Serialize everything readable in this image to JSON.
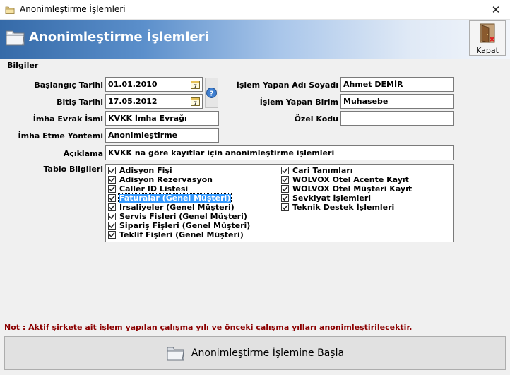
{
  "window": {
    "title": "Anonimleştirme İşlemleri",
    "close_glyph": "✕"
  },
  "header": {
    "title": "Anonimleştirme İşlemleri",
    "icon": "folder-icon"
  },
  "toolbar": {
    "close_label": "Kapat",
    "close_icon": "door-exit-icon"
  },
  "form": {
    "group_label": "Bilgiler",
    "start_date_label": "Başlangıç Tarihi",
    "start_date_value": "01.01.2010",
    "end_date_label": "Bitiş Tarihi",
    "end_date_value": "17.05.2012",
    "doc_name_label": "İmha Evrak İsmi",
    "doc_name_value": "KVKK İmha Evrağı",
    "method_label": "İmha Etme Yöntemi",
    "method_value": "Anonimleştirme",
    "user_label": "İşlem Yapan Adı Soyadı",
    "user_value": "Ahmet DEMİR",
    "unit_label": "İşlem Yapan Birim",
    "unit_value": "Muhasebe",
    "special_code_label": "Özel Kodu",
    "special_code_value": "",
    "description_label": "Açıklama",
    "description_value": "KVKK na göre kayıtlar için anonimleştirme işlemleri",
    "tables_label": "Tablo Bilgileri"
  },
  "tables": {
    "left": [
      {
        "label": "Adisyon Fişi",
        "checked": true,
        "selected": false
      },
      {
        "label": "Adisyon Rezervasyon",
        "checked": true,
        "selected": false
      },
      {
        "label": "Caller ID Listesi",
        "checked": true,
        "selected": false
      },
      {
        "label": "Faturalar (Genel Müşteri)",
        "checked": true,
        "selected": true
      },
      {
        "label": "İrsaliyeler (Genel Müşteri)",
        "checked": true,
        "selected": false
      },
      {
        "label": "Servis Fişleri (Genel Müşteri)",
        "checked": true,
        "selected": false
      },
      {
        "label": "Sipariş Fişleri (Genel Müşteri)",
        "checked": true,
        "selected": false
      },
      {
        "label": "Teklif Fişleri (Genel Müşteri)",
        "checked": true,
        "selected": false
      }
    ],
    "right": [
      {
        "label": "Cari Tanımları",
        "checked": true,
        "selected": false
      },
      {
        "label": "WOLVOX Otel Acente Kayıt",
        "checked": true,
        "selected": false
      },
      {
        "label": "WOLVOX Otel Müşteri Kayıt",
        "checked": true,
        "selected": false
      },
      {
        "label": "Sevkiyat İşlemleri",
        "checked": true,
        "selected": false
      },
      {
        "label": "Teknik Destek İşlemleri",
        "checked": true,
        "selected": false
      }
    ]
  },
  "note": "Not : Aktif şirkete ait işlem yapılan çalışma yılı ve önceki çalışma yılları anonimleştirilecektir.",
  "actions": {
    "start_label": "Anonimleştirme İşlemine Başla"
  },
  "colors": {
    "note": "#8b0000",
    "selection": "#3399ff",
    "header_gradient_start": "#356aa8"
  }
}
